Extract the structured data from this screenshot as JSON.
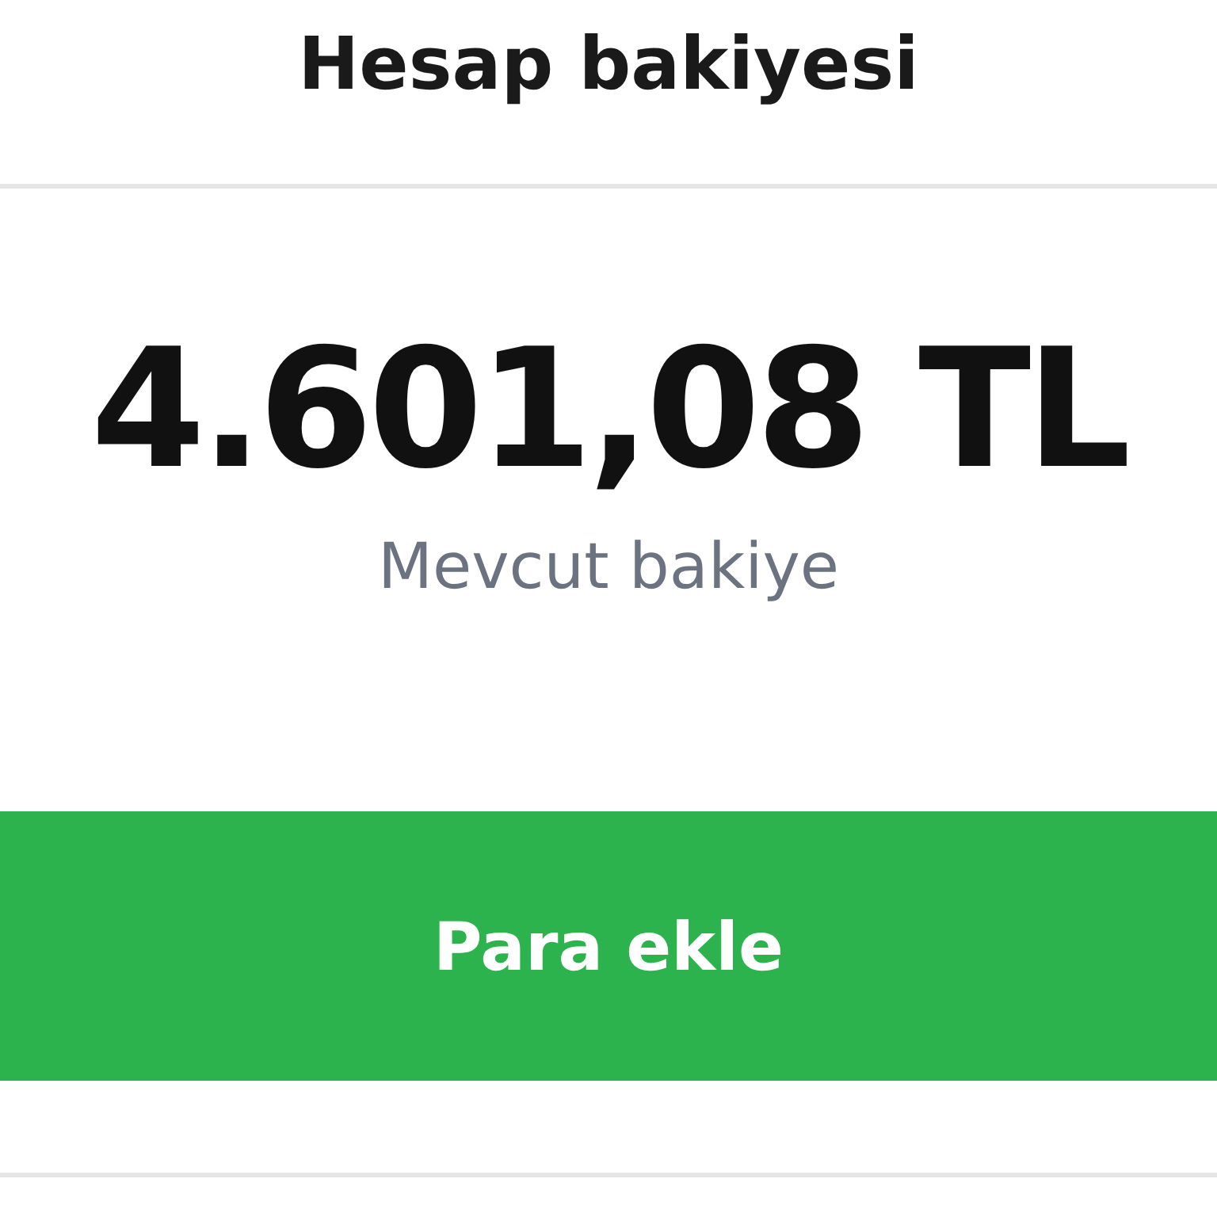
{
  "header": {
    "title": "Hesap bakiyesi"
  },
  "balance": {
    "amount": "4.601,08 TL",
    "caption": "Mevcut bakiye"
  },
  "button": {
    "label": "Para ekle"
  }
}
